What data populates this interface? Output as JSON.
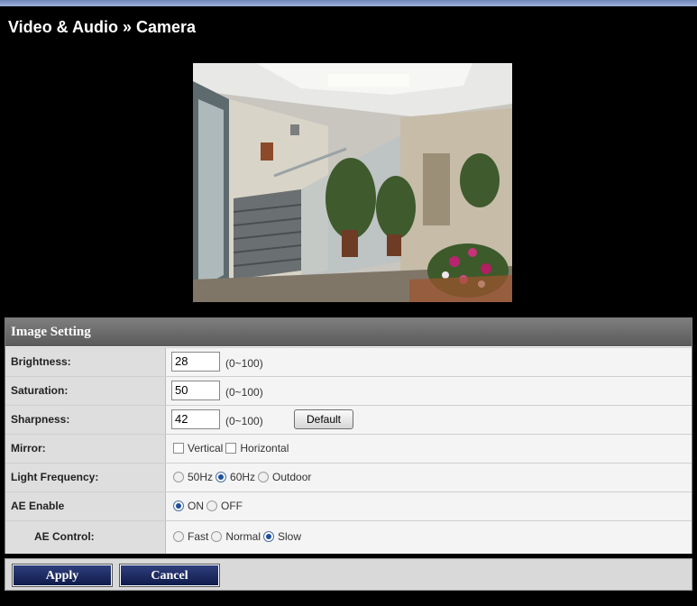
{
  "page": {
    "title": "Video & Audio » Camera"
  },
  "image_setting": {
    "header": "Image Setting",
    "brightness": {
      "label": "Brightness:",
      "value": "28",
      "range": "(0~100)"
    },
    "saturation": {
      "label": "Saturation:",
      "value": "50",
      "range": "(0~100)"
    },
    "sharpness": {
      "label": "Sharpness:",
      "value": "42",
      "range": "(0~100)",
      "default_button": "Default"
    },
    "mirror": {
      "label": "Mirror:",
      "options": [
        "Vertical",
        "Horizontal"
      ],
      "checked": []
    },
    "light_frequency": {
      "label": "Light Frequency:",
      "options": [
        "50Hz",
        "60Hz",
        "Outdoor"
      ],
      "selected": "60Hz"
    },
    "ae_enable": {
      "label": "AE Enable",
      "options": [
        "ON",
        "OFF"
      ],
      "selected": "ON"
    },
    "ae_control": {
      "label": "AE Control:",
      "options": [
        "Fast",
        "Normal",
        "Slow"
      ],
      "selected": "Slow"
    }
  },
  "footer": {
    "apply_label": "Apply",
    "cancel_label": "Cancel"
  },
  "colors": {
    "background": "#000000",
    "panel_header": "#666666",
    "button": "#1c2a63"
  },
  "icons": {
    "checkbox": "checkbox-icon",
    "radio": "radio-icon"
  }
}
